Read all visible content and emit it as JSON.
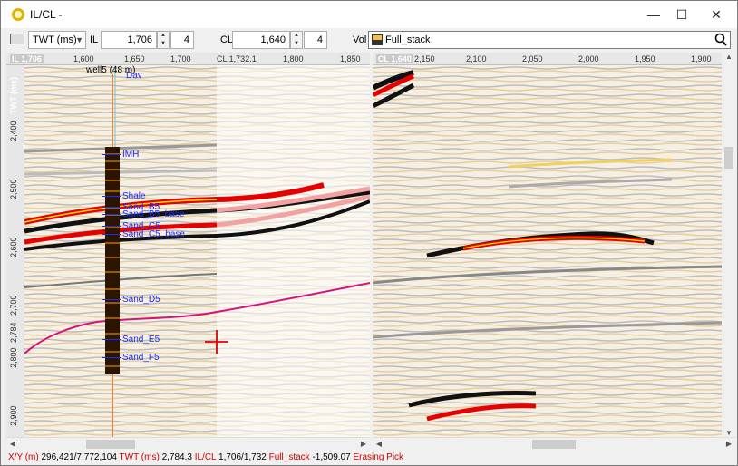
{
  "window": {
    "title": "IL/CL -",
    "minimize": "—",
    "maximize": "☐",
    "close": "✕"
  },
  "toolbar": {
    "domain": "TWT (ms)",
    "il_label": "IL",
    "il_value": "1,706",
    "il_step": "4",
    "cl_label": "CL",
    "cl_value": "1,640",
    "cl_step": "4",
    "vol_label": "Vol",
    "vol_value": "Full_stack"
  },
  "left_panel": {
    "header": "IL 1,706",
    "x_ticks": [
      "1,600",
      "1,650",
      "1,700",
      "CL 1,732.1",
      "1,800",
      "1,850"
    ],
    "y_ticks": [
      "TWT (ms)",
      "2,400",
      "2,500",
      "2,600",
      "2,700",
      "2,784",
      "2,800",
      "2,900"
    ]
  },
  "right_panel": {
    "header": "CL 1,640",
    "x_ticks": [
      "2,150",
      "2,100",
      "2,050",
      "2,000",
      "1,950",
      "1,900"
    ]
  },
  "well": {
    "name": "well5 (48 m)",
    "sub": "Dav",
    "markers": [
      "IMH",
      "Shale",
      "Sand_B5",
      "Sand_B5_base",
      "Sand_C5",
      "Sand_C5_base",
      "Sand_D5",
      "Sand_E5",
      "Sand_F5"
    ]
  },
  "status": {
    "xy_label": "X/Y (m)",
    "xy_value": "296,421/7,772,104",
    "twt_label": "TWT (ms)",
    "twt_value": "2,784.3",
    "ilcl_label": "IL/CL",
    "ilcl_value": "1,706/1,732",
    "stack_label": "Full_stack",
    "stack_value": "-1,509.07",
    "mode": "Erasing Pick"
  },
  "colors": {
    "horizon": "#d4147c",
    "marker": "#1a2aff",
    "status_key": "#d00000",
    "cursor": "#e00000"
  }
}
